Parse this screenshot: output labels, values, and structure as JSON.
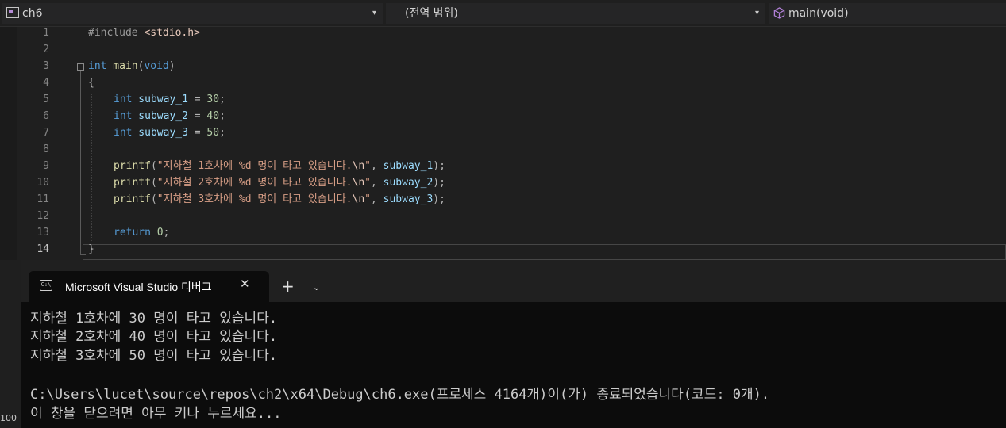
{
  "navbar": {
    "project": "ch6",
    "scope": "(전역 범위)",
    "member": "main(void)",
    "arrow": "▾"
  },
  "editor": {
    "line_numbers": [
      "1",
      "2",
      "3",
      "4",
      "5",
      "6",
      "7",
      "8",
      "9",
      "10",
      "11",
      "12",
      "13",
      "14"
    ],
    "current_line": "14",
    "code": {
      "l1_a": "#include ",
      "l1_b": "<stdio.h>",
      "l3_int": "int",
      "l3_main": " main",
      "l3_open": "(",
      "l3_void": "void",
      "l3_close": ")",
      "l4": "{",
      "l5_kw": "int",
      "l5_var": " subway_1",
      "l5_eq": " = ",
      "l5_num": "30",
      "l5_end": ";",
      "l6_kw": "int",
      "l6_var": " subway_2",
      "l6_eq": " = ",
      "l6_num": "40",
      "l6_end": ";",
      "l7_kw": "int",
      "l7_var": " subway_3",
      "l7_eq": " = ",
      "l7_num": "50",
      "l7_end": ";",
      "l9_fn": "printf",
      "l9_open": "(",
      "l9_str": "\"지하철 1호차에 %d 명이 타고 있습니다.",
      "l9_esc": "\\n",
      "l9_q": "\"",
      "l9_comma": ", ",
      "l9_var": "subway_1",
      "l9_end": ");",
      "l10_fn": "printf",
      "l10_open": "(",
      "l10_str": "\"지하철 2호차에 %d 명이 타고 있습니다.",
      "l10_esc": "\\n",
      "l10_q": "\"",
      "l10_comma": ", ",
      "l10_var": "subway_2",
      "l10_end": ");",
      "l11_fn": "printf",
      "l11_open": "(",
      "l11_str": "\"지하철 3호차에 %d 명이 타고 있습니다.",
      "l11_esc": "\\n",
      "l11_q": "\"",
      "l11_comma": ", ",
      "l11_var": "subway_3",
      "l11_end": ");",
      "l13_kw": "return",
      "l13_sp": " ",
      "l13_num": "0",
      "l13_end": ";",
      "l14": "}"
    }
  },
  "terminal": {
    "tab_title": "Microsoft Visual Studio 디버그",
    "tab_icon_text": "C:\\",
    "close": "✕",
    "add": "+",
    "menu": "⌄",
    "output": [
      "지하철 1호차에 30 명이 타고 있습니다.",
      "지하철 2호차에 40 명이 타고 있습니다.",
      "지하철 3호차에 50 명이 타고 있습니다.",
      "",
      "C:\\Users\\lucet\\source\\repos\\ch2\\x64\\Debug\\ch6.exe(프로세스 4164개)이(가) 종료되었습니다(코드: 0개).",
      "이 창을 닫으려면 아무 키나 누르세요..."
    ]
  },
  "zoom": "100"
}
